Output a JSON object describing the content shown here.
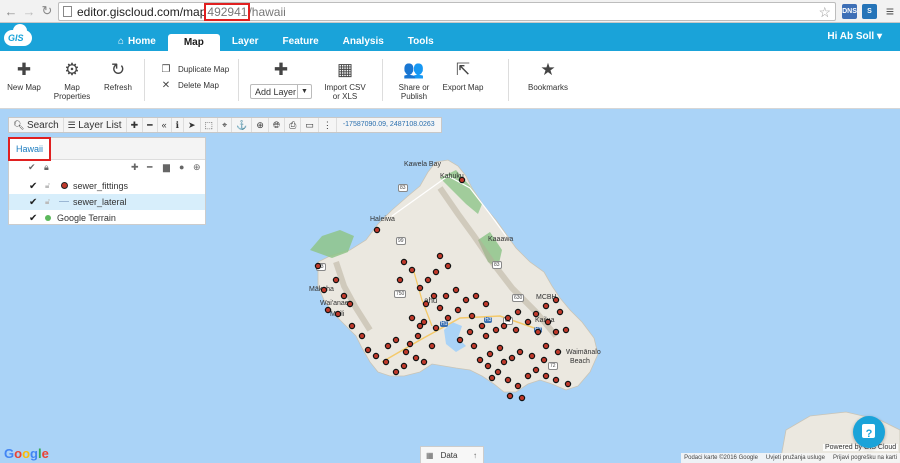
{
  "browser": {
    "url_prefix": "editor.giscloud.com/map",
    "url_id": "492941",
    "url_suffix": "/hawaii",
    "ext1_label": "DNS",
    "ext2_label": "S"
  },
  "app": {
    "logo_text": "GIS",
    "tabs": [
      {
        "label": "Home"
      },
      {
        "label": "Map"
      },
      {
        "label": "Layer"
      },
      {
        "label": "Feature"
      },
      {
        "label": "Analysis"
      },
      {
        "label": "Tools"
      }
    ],
    "user_label": "Hi Ab Soll ▾"
  },
  "ribbon": {
    "new_map": "New Map",
    "map_properties_1": "Map",
    "map_properties_2": "Properties",
    "refresh": "Refresh",
    "duplicate_map": "Duplicate Map",
    "delete_map": "Delete Map",
    "add_layer": "Add Layer",
    "import_1": "Import CSV",
    "import_2": "or XLS",
    "share_1": "Share or",
    "share_2": "Publish",
    "export_map": "Export Map",
    "bookmarks": "Bookmarks"
  },
  "map_toolbar": {
    "search": "Search",
    "layer_list": "Layer List",
    "coords": "-17587090.09, 2487108.0263"
  },
  "layer_panel": {
    "title": "Hawaii",
    "layers": [
      {
        "name": "sewer_fittings",
        "color": "#c0392b"
      },
      {
        "name": "sewer_lateral",
        "color": "#9bb7d4"
      },
      {
        "name": "Google Terrain",
        "color": "#5cb85c"
      }
    ]
  },
  "map_labels": {
    "kawela": "Kawela Bay",
    "kahuku": "Kahuku",
    "haleiwa": "Haleiwa",
    "kaaawa": "Kaaawa",
    "makaha": "Mākaha",
    "waianae": "Wai'anae",
    "maili": "Māili",
    "mcbh": "MCBH",
    "kailua": "Kailua",
    "hawaii_kai": "Hawaii Kai",
    "waimanalo": "Waimānalo",
    "beach": "Beach",
    "ahu": "ahu",
    "shield_83a": "83",
    "shield_83b": "83",
    "shield_99": "99",
    "shield_93": "93",
    "shield_750": "750",
    "shield_630": "630",
    "shield_61": "61",
    "shield_72": "72",
    "shield_h1": "H1",
    "shield_h3": "H3",
    "shield_h2": "H2"
  },
  "bottom": {
    "google": "Google",
    "data_tab": "Data",
    "powered": "Powered by GIS Cloud",
    "attrib_1": "Podaci karte ©2016 Google",
    "attrib_2": "Uvjeti pružanja usluge",
    "attrib_3": "Prijavi pogrešku na karti",
    "help": "?"
  },
  "colors": {
    "accent": "#1aa3d9",
    "water": "#aad3f7",
    "land": "#e9e6df",
    "vegetation": "#8fc48a",
    "point": "#c0392b",
    "highlight": "#e02020"
  }
}
